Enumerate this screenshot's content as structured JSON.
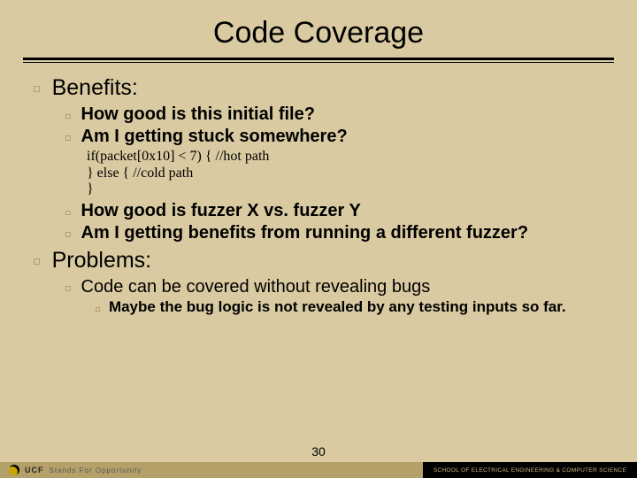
{
  "title": "Code Coverage",
  "sections": [
    {
      "heading": "Benefits:",
      "items_a": [
        "How good is this initial file?",
        "Am I getting stuck somewhere?"
      ],
      "code": [
        "if(packet[0x10] < 7) { //hot path",
        "} else { //cold path",
        "}"
      ],
      "items_b": [
        "How good is fuzzer X vs. fuzzer Y",
        "Am I getting benefits from running a different fuzzer?"
      ]
    },
    {
      "heading": "Problems:",
      "items": [
        {
          "text": "Code can be covered without revealing bugs",
          "sub": [
            "Maybe the bug logic is not revealed by any testing inputs so far."
          ]
        }
      ]
    }
  ],
  "page_number": "30",
  "footer": {
    "ucf": "UCF",
    "tagline": "Stands For Opportunity",
    "school": "SCHOOL OF ELECTRICAL ENGINEERING & COMPUTER SCIENCE"
  }
}
